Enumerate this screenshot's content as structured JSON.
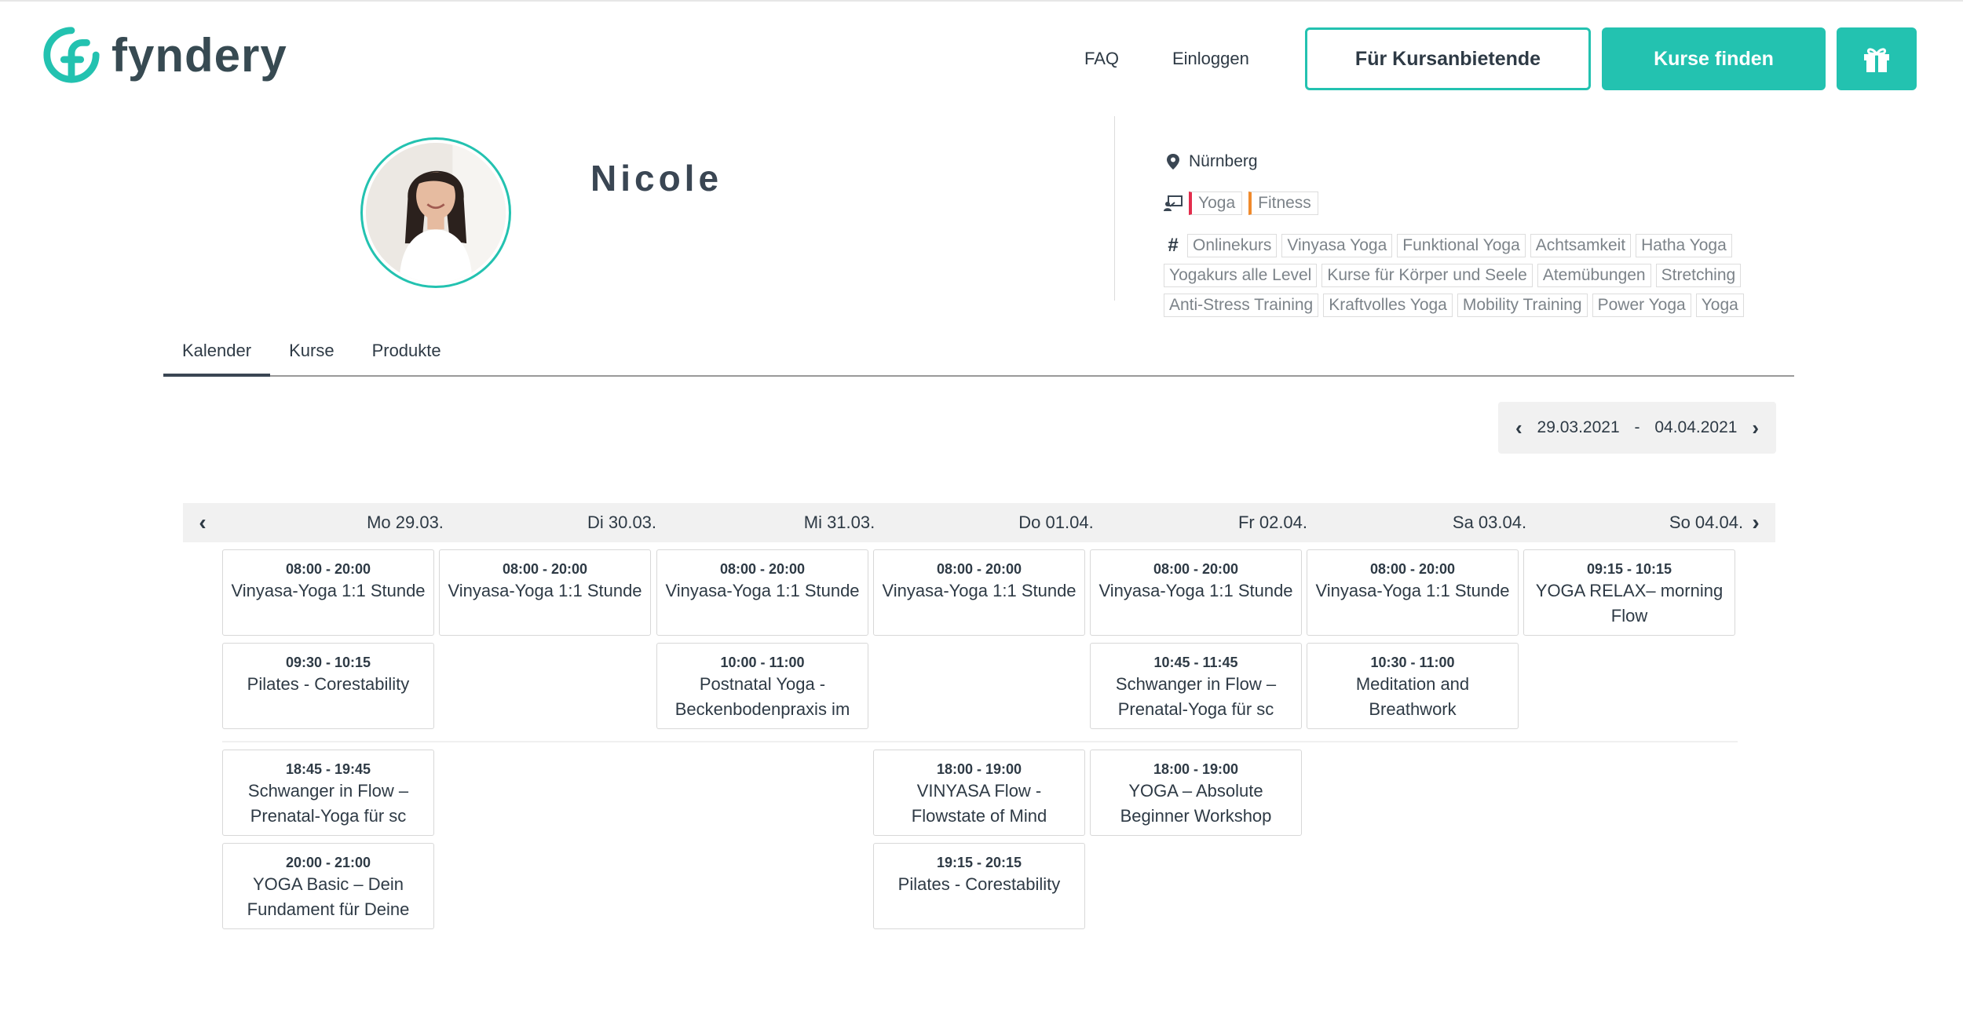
{
  "header": {
    "logo_text": "fyndery",
    "nav": {
      "faq": "FAQ",
      "login": "Einloggen"
    },
    "provider_button": "Für Kursanbietende",
    "find_button": "Kurse finden",
    "brand_color": "#23c2b0"
  },
  "profile": {
    "name": "Nicole",
    "location": "Nürnberg",
    "categories": [
      "Yoga",
      "Fitness"
    ],
    "tag_rows": [
      [
        "Onlinekurs",
        "Vinyasa Yoga",
        "Funktional Yoga",
        "Achtsamkeit",
        "Hatha Yoga"
      ],
      [
        "Yogakurs alle Level",
        "Kurse für Körper und Seele",
        "Atemübungen",
        "Stretching"
      ],
      [
        "Anti-Stress Training",
        "Kraftvolles Yoga",
        "Mobility Training",
        "Power Yoga",
        "Yoga"
      ]
    ]
  },
  "tabs": [
    "Kalender",
    "Kurse",
    "Produkte"
  ],
  "date_range": {
    "start": "29.03.2021",
    "separator": "-",
    "end": "04.04.2021"
  },
  "calendar": {
    "days": [
      "Mo 29.03.",
      "Di 30.03.",
      "Mi 31.03.",
      "Do 01.04.",
      "Fr 02.04.",
      "Sa 03.04.",
      "So 04.04."
    ],
    "events": [
      {
        "day": 0,
        "slot": 0,
        "time": "08:00 - 20:00",
        "title": "Vinyasa-Yoga 1:1 Stunde"
      },
      {
        "day": 1,
        "slot": 0,
        "time": "08:00 - 20:00",
        "title": "Vinyasa-Yoga 1:1 Stunde"
      },
      {
        "day": 2,
        "slot": 0,
        "time": "08:00 - 20:00",
        "title": "Vinyasa-Yoga 1:1 Stunde"
      },
      {
        "day": 3,
        "slot": 0,
        "time": "08:00 - 20:00",
        "title": "Vinyasa-Yoga 1:1 Stunde"
      },
      {
        "day": 4,
        "slot": 0,
        "time": "08:00 - 20:00",
        "title": "Vinyasa-Yoga 1:1 Stunde"
      },
      {
        "day": 5,
        "slot": 0,
        "time": "08:00 - 20:00",
        "title": "Vinyasa-Yoga 1:1 Stunde"
      },
      {
        "day": 6,
        "slot": 0,
        "time": "09:15 - 10:15",
        "title": "YOGA RELAX– morning Flow"
      },
      {
        "day": 0,
        "slot": 1,
        "time": "09:30 - 10:15",
        "title": "Pilates - Corestability"
      },
      {
        "day": 2,
        "slot": 1,
        "time": "10:00 - 11:00",
        "title": "Postnatal Yoga - Beckenbodenpraxis im"
      },
      {
        "day": 4,
        "slot": 1,
        "time": "10:45 - 11:45",
        "title": "Schwanger in Flow – Prenatal-Yoga für sc"
      },
      {
        "day": 5,
        "slot": 1,
        "time": "10:30 - 11:00",
        "title": "Meditation and Breathwork"
      },
      {
        "day": 0,
        "slot": 2,
        "time": "18:45 - 19:45",
        "title": "Schwanger in Flow – Prenatal-Yoga für sc"
      },
      {
        "day": 3,
        "slot": 2,
        "time": "18:00 - 19:00",
        "title": "VINYASA Flow - Flowstate of Mind"
      },
      {
        "day": 4,
        "slot": 2,
        "time": "18:00 - 19:00",
        "title": "YOGA – Absolute Beginner Workshop"
      },
      {
        "day": 0,
        "slot": 3,
        "time": "20:00 - 21:00",
        "title": "YOGA Basic – Dein Fundament für Deine"
      },
      {
        "day": 3,
        "slot": 3,
        "time": "19:15 - 20:15",
        "title": "Pilates - Corestability"
      }
    ]
  },
  "icons": {
    "location": "map-pin-icon",
    "category": "teacher-board-icon",
    "tags": "hash-icon",
    "gift": "gift-icon",
    "prev": "chevron-left-icon",
    "next": "chevron-right-icon"
  }
}
